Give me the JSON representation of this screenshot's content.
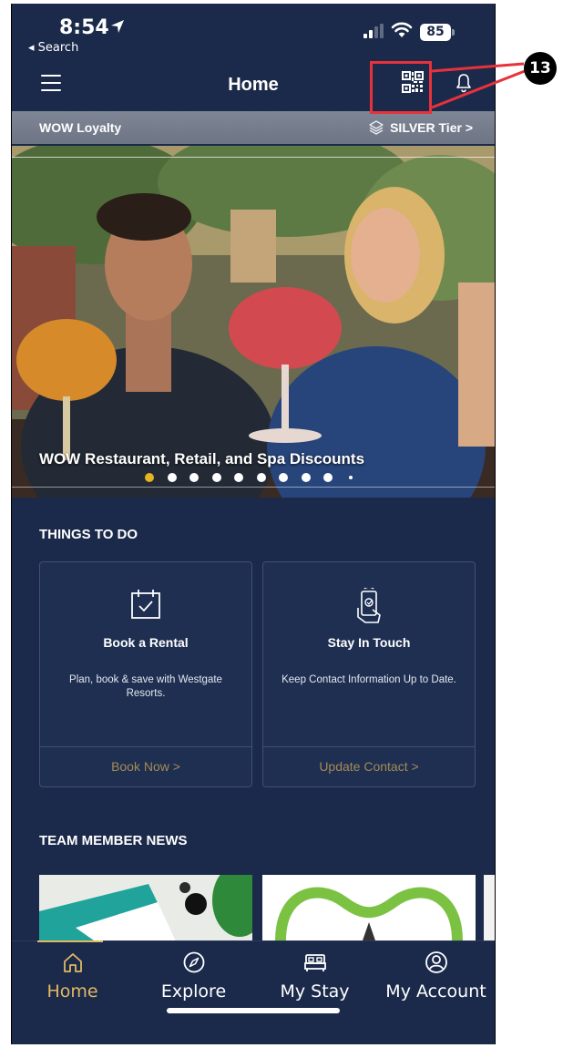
{
  "status_bar": {
    "time": "8:54",
    "back_label": "◂ Search",
    "battery": "85"
  },
  "header": {
    "title": "Home"
  },
  "loyalty": {
    "label": "WOW Loyalty",
    "tier": "SILVER Tier >"
  },
  "hero": {
    "title": "WOW Restaurant, Retail, and Spa Discounts",
    "slide_count": 10,
    "active_slide": 1
  },
  "things_to_do": {
    "title": "THINGS TO DO",
    "cards": [
      {
        "title": "Book a Rental",
        "description": "Plan, book & save with Westgate Resorts.",
        "link": "Book Now  >",
        "icon": "calendar-check-icon"
      },
      {
        "title": "Stay In Touch",
        "description": "Keep Contact Information Up to Date.",
        "link": "Update Contact  >",
        "icon": "phone-in-hand-icon"
      }
    ]
  },
  "team_news": {
    "title": "TEAM MEMBER NEWS"
  },
  "tabs": [
    {
      "label": "Home",
      "icon": "home-icon",
      "active": true
    },
    {
      "label": "Explore",
      "icon": "compass-icon",
      "active": false
    },
    {
      "label": "My Stay",
      "icon": "bed-icon",
      "active": false
    },
    {
      "label": "My Account",
      "icon": "user-circle-icon",
      "active": false
    }
  ],
  "annotation": {
    "badge": "13"
  },
  "colors": {
    "background": "#1b2a4a",
    "accent_gold": "#e2b863",
    "link_gold": "#a68a55",
    "annotation_red": "#e8313a"
  }
}
